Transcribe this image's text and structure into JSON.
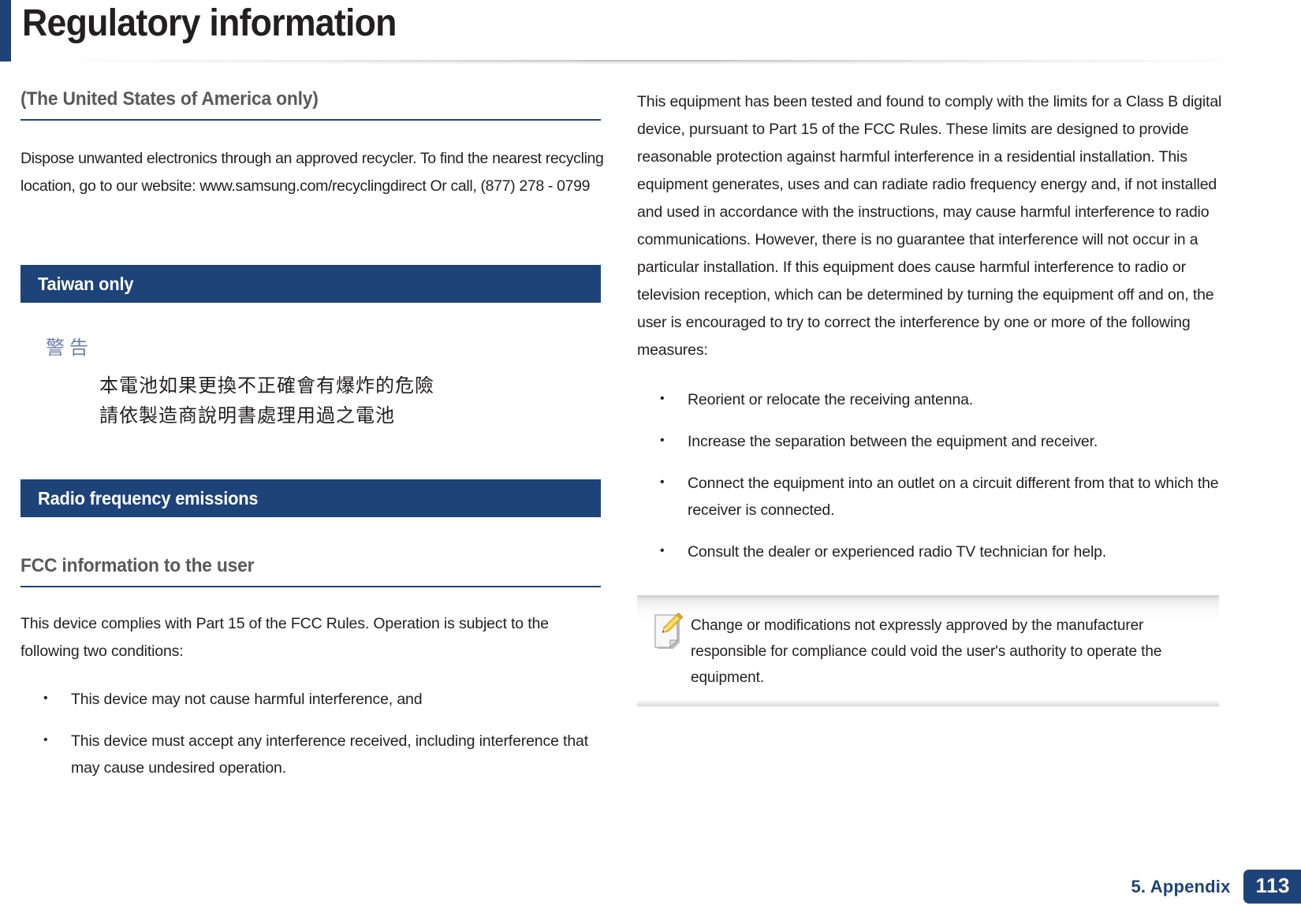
{
  "document": {
    "title": "Regulatory information"
  },
  "left_column": {
    "section_usa": {
      "heading": "(The United States of America only)",
      "paragraph": "Dispose unwanted electronics through an approved recycler. To find the nearest recycling location, go to our website: www.samsung.com/recyclingdirect Or call, (877) 278 - 0799"
    },
    "section_taiwan": {
      "banner": "Taiwan only",
      "warning_title": "警告",
      "warning_line1": "本電池如果更換不正確會有爆炸的危險",
      "warning_line2": "請依製造商說明書處理用過之電池"
    },
    "section_rf": {
      "banner": "Radio frequency emissions",
      "subheading": "FCC information to the user",
      "paragraph": "This device complies with Part 15 of the FCC Rules. Operation is subject to the following two conditions:",
      "bullets": [
        "This device may not cause harmful interference, and",
        "This device must accept any interference received, including interference that may cause undesired operation."
      ]
    }
  },
  "right_column": {
    "paragraph": "This equipment has been tested and found to comply with the limits for a Class B digital device, pursuant to Part 15 of the FCC Rules. These limits are designed to provide reasonable protection against harmful interference in a residential installation. This equipment generates, uses and can radiate radio frequency energy and, if not installed and used in accordance with the instructions, may cause harmful interference to radio communications. However, there is no guarantee that interference will not occur in a particular installation. If this equipment does cause harmful interference to radio or television reception, which can be determined by turning the equipment off and on, the user is encouraged to try to correct the interference by one or more of the following measures:",
    "bullets": [
      "Reorient or relocate the receiving antenna.",
      "Increase the separation between the equipment and receiver.",
      "Connect the equipment into an outlet on a circuit different from that to which the receiver is connected.",
      "Consult the dealer or experienced radio TV technician for help."
    ],
    "note": {
      "icon": "note-pencil-icon",
      "text": "Change or modifications not expressly approved by the manufacturer responsible for compliance could void the user's authority to operate the equipment."
    }
  },
  "footer": {
    "chapter": "5.  Appendix",
    "page_number": "113"
  },
  "colors": {
    "accent_blue": "#1e4379",
    "subhead_gray": "#58595b",
    "body_text": "#231f20",
    "cjk_warning": "#6f7cab"
  }
}
